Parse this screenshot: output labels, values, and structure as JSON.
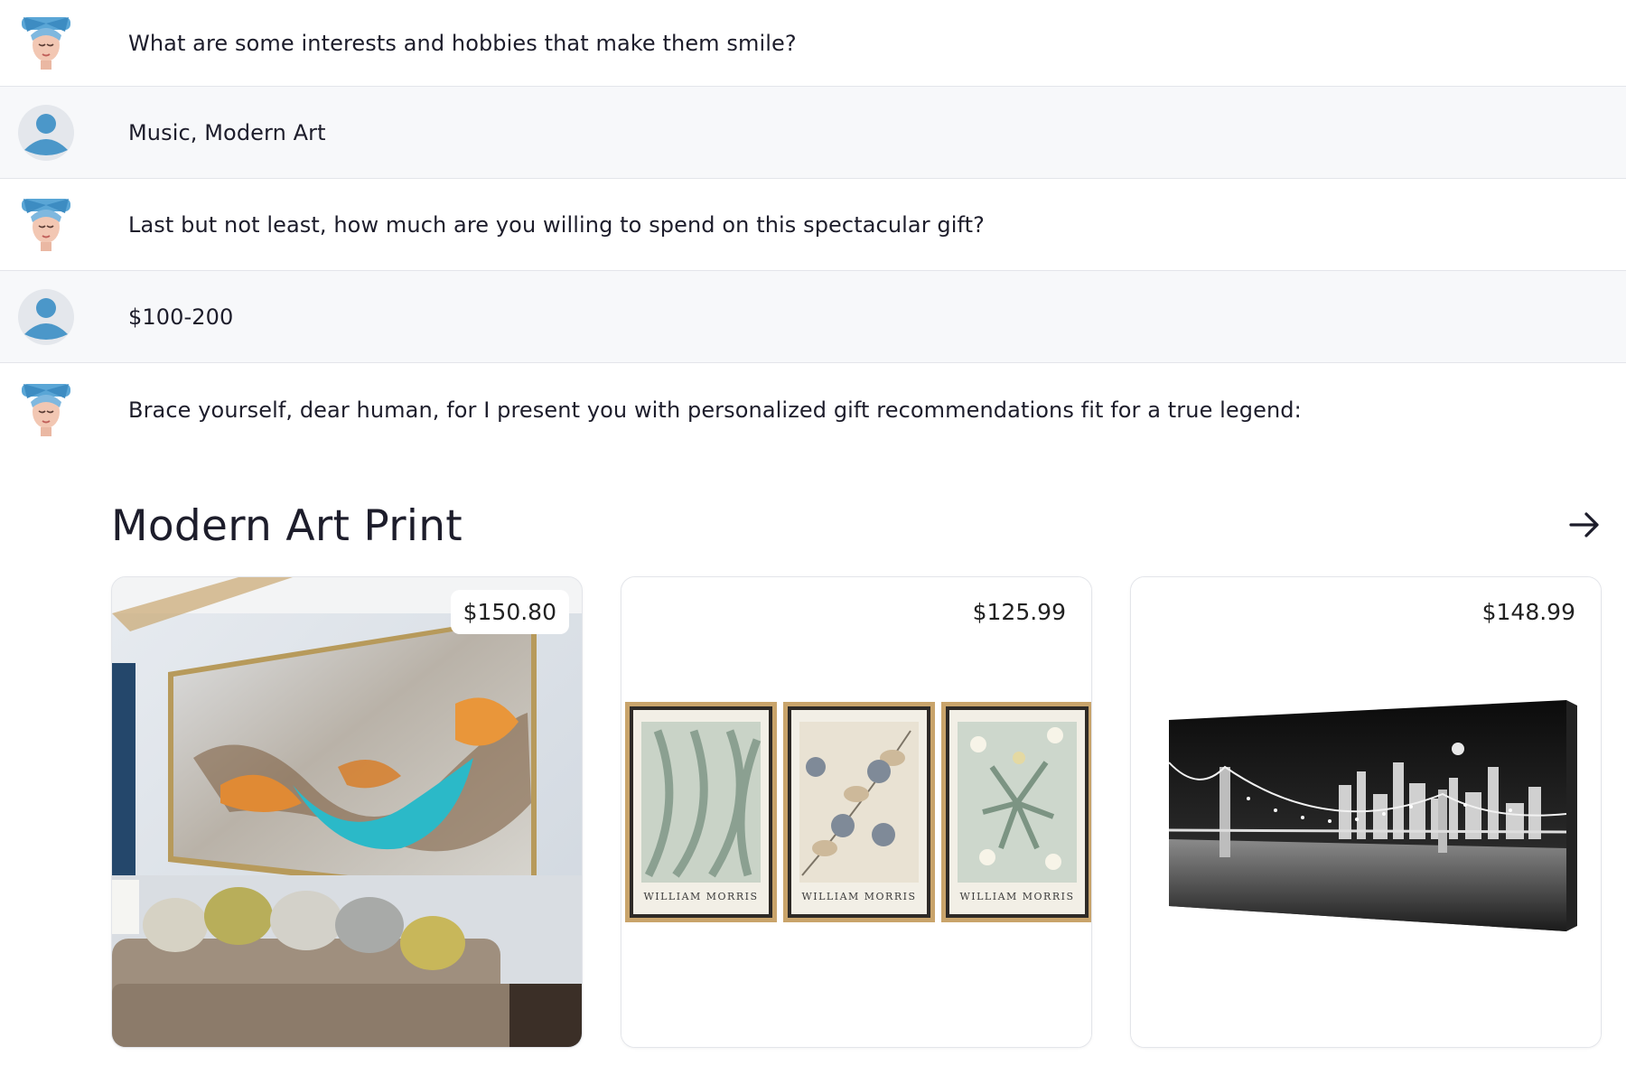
{
  "messages": [
    {
      "role": "bot",
      "avatar": "bot-girl-avatar",
      "text": "What are some interests and hobbies that make them smile?"
    },
    {
      "role": "user",
      "avatar": "user-avatar",
      "text": "Music, Modern Art"
    },
    {
      "role": "bot",
      "avatar": "bot-girl-avatar",
      "text": "Last but not least, how much are you willing to spend on this spectacular gift?"
    },
    {
      "role": "user",
      "avatar": "user-avatar",
      "text": "$100-200"
    },
    {
      "role": "bot",
      "avatar": "bot-girl-avatar",
      "text": "Brace yourself, dear human, for I present you with personalized gift recommendations fit for a true legend:"
    }
  ],
  "recommendations": {
    "title": "Modern Art Print",
    "next_icon": "arrow-right-icon",
    "products": [
      {
        "price": "$150.80",
        "image": "abstract-canvas-in-living-room"
      },
      {
        "price": "$125.99",
        "image": "william-morris-triptych",
        "print_labels": [
          "WILLIAM MORRIS",
          "WILLIAM MORRIS",
          "WILLIAM MORRIS"
        ]
      },
      {
        "price": "$148.99",
        "image": "brooklyn-bridge-night-canvas"
      }
    ]
  },
  "colors": {
    "user_row_bg": "#f7f8fa",
    "divider": "#e3e5ea",
    "user_avatar": "#4b97c9",
    "bot_bow": "#5aa6d6"
  }
}
